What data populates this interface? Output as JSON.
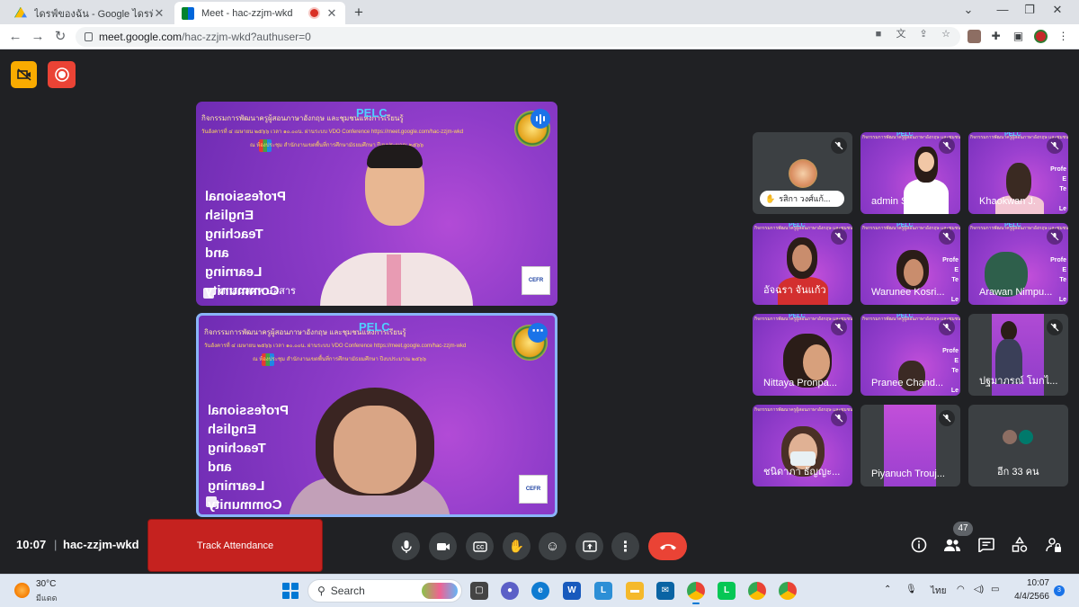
{
  "browser": {
    "tabs": [
      {
        "title": "ไดรฟ์ของฉัน - Google ไดรฟ์",
        "active": false
      },
      {
        "title": "Meet - hac-zzjm-wkd",
        "active": true
      }
    ],
    "url_host": "meet.google.com",
    "url_path": "/hac-zzjm-wkd?authuser=0"
  },
  "meet": {
    "clock": "10:07",
    "separator": "|",
    "meeting_code": "hac-zzjm-wkd",
    "track_attendance_label": "Track Attendance",
    "participant_count": "47",
    "presentation": {
      "banner_line1": "กิจกรรมการพัฒนาครูผู้สอนภาษาอังกฤษ และชุมชนแห่งการเรียนรู้",
      "pelc": "PELC",
      "banner_line2": "วันอังคารที่ ๔ เมษายน ๒๕๖๖ เวลา ๑๐.๐๐น. ผ่านระบบ VDO Conference https://meet.google.com/hac-zzjm-wkd",
      "banner_line3": "ณ ห้องประชุม สำนักงานเขตพื้นที่การศึกษามัธยมศึกษา ปีงบประมาณ ๒๕๖๖",
      "mirror_words": [
        "Professional",
        "English",
        "Teaching",
        "and",
        "Learning",
        "Community"
      ],
      "cefr": "CEFR"
    },
    "main_tiles": [
      {
        "name": "ศกสนสคห ษอสาร"
      },
      {
        "name": ""
      }
    ],
    "grid_tiles": [
      {
        "name": "รสิกา วงศ์แก้...",
        "hand_raised": true
      },
      {
        "name": "admin Sri..."
      },
      {
        "name": "Khaokwan J."
      },
      {
        "name": "อัจฉรา จันแก้ว"
      },
      {
        "name": "Warunee Kosri..."
      },
      {
        "name": "Arawan Nimpu..."
      },
      {
        "name": "Nittaya Pronpa..."
      },
      {
        "name": "Pranee Chand..."
      },
      {
        "name": "ปฐมาภรณ์ โมกไ..."
      },
      {
        "name": "ชนิดาภา ธัญญะ..."
      },
      {
        "name": "Piyanuch Trouj..."
      },
      {
        "name": "อีก 33 คน"
      }
    ],
    "tile_side_text": "Profe\nE\nTe\n\nLe\nCom"
  },
  "taskbar": {
    "weather_temp": "30°C",
    "weather_desc": "มีแดด",
    "search_label": "Search",
    "lang": "ไทย",
    "time": "10:07",
    "date": "4/4/2566",
    "notif_count": "3"
  },
  "colors": {
    "meet_bg": "#202124",
    "end_call": "#ea4335",
    "track_btn": "#c5221f",
    "tile_purple": "#9a40cf",
    "accent_blue": "#1a73e8"
  }
}
